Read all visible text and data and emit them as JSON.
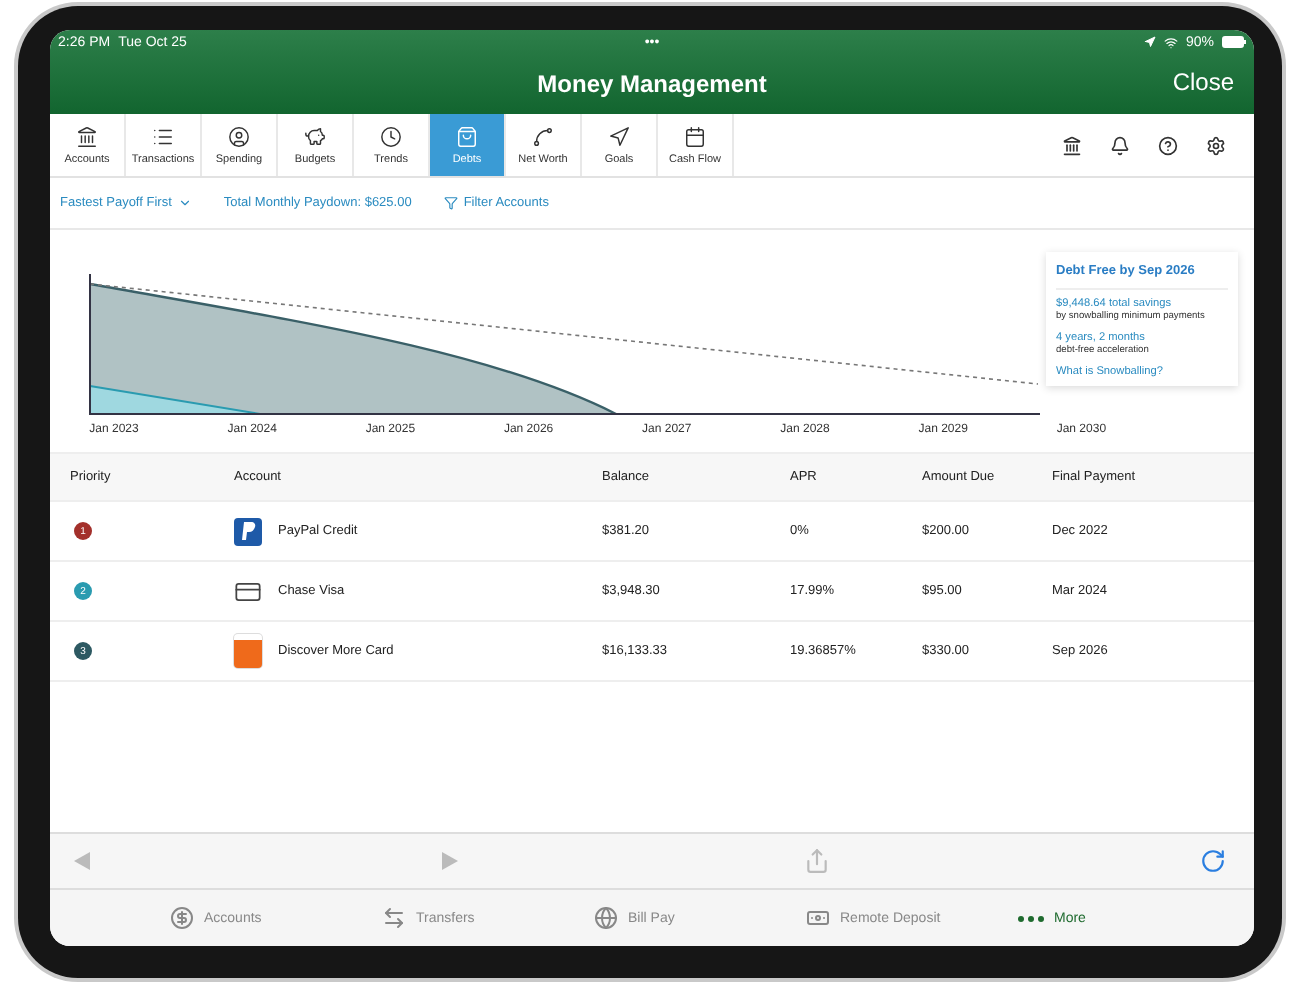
{
  "status_bar": {
    "time": "2:26 PM",
    "date": "Tue Oct 25",
    "dots": "•••",
    "battery": "90%"
  },
  "header": {
    "title": "Money Management",
    "close": "Close"
  },
  "nav_tabs": [
    {
      "label": "Accounts",
      "selected": false
    },
    {
      "label": "Transactions",
      "selected": false
    },
    {
      "label": "Spending",
      "selected": false
    },
    {
      "label": "Budgets",
      "selected": false
    },
    {
      "label": "Trends",
      "selected": false
    },
    {
      "label": "Debts",
      "selected": true
    },
    {
      "label": "Net Worth",
      "selected": false
    },
    {
      "label": "Goals",
      "selected": false
    },
    {
      "label": "Cash Flow",
      "selected": false
    }
  ],
  "filters": {
    "sort": "Fastest Payoff First",
    "paydown": "Total Monthly Paydown: $625.00",
    "filter": "Filter Accounts"
  },
  "chart": {
    "x_labels": [
      "Jan 2023",
      "Jan 2024",
      "Jan 2025",
      "Jan 2026",
      "Jan 2027",
      "Jan 2028",
      "Jan 2029",
      "Jan 2030"
    ],
    "summary": {
      "title": "Debt Free by Sep 2026",
      "savings": "$9,448.64 total savings",
      "savings_note": "by snowballing minimum payments",
      "acceleration": "4 years, 2 months",
      "acceleration_note": "debt-free acceleration",
      "link": "What is Snowballing?"
    }
  },
  "table": {
    "columns": [
      "Priority",
      "Account",
      "Balance",
      "APR",
      "Amount Due",
      "Final Payment"
    ],
    "rows": [
      {
        "priority": "1",
        "color": "#a3302b",
        "kind": "paypal",
        "account": "PayPal Credit",
        "balance": "$381.20",
        "apr": "0%",
        "amount_due": "$200.00",
        "final_payment": "Dec 2022"
      },
      {
        "priority": "2",
        "color": "#2a9bb0",
        "kind": "card",
        "account": "Chase Visa",
        "balance": "$3,948.30",
        "apr": "17.99%",
        "amount_due": "$95.00",
        "final_payment": "Mar 2024"
      },
      {
        "priority": "3",
        "color": "#2d5962",
        "kind": "discover",
        "account": "Discover More Card",
        "balance": "$16,133.33",
        "apr": "19.36857%",
        "amount_due": "$330.00",
        "final_payment": "Sep 2026"
      }
    ]
  },
  "tab_bar": [
    {
      "label": "Accounts",
      "selected": false
    },
    {
      "label": "Transfers",
      "selected": false
    },
    {
      "label": "Bill Pay",
      "selected": false
    },
    {
      "label": "Remote Deposit",
      "selected": false
    },
    {
      "label": "More",
      "selected": true
    }
  ]
}
